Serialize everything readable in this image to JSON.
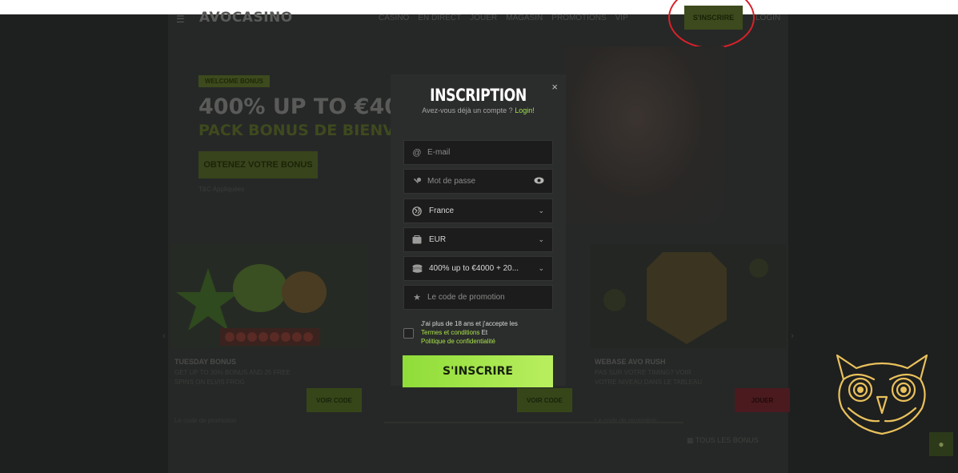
{
  "header": {
    "logo": "AVOCASINO",
    "nav": [
      "CASINO",
      "EN DIRECT",
      "JOUER",
      "MAGASIN",
      "PROMOTIONS",
      "VIP"
    ],
    "register": "S'INSCRIRE",
    "login": "LOGIN"
  },
  "hero": {
    "badge": "WELCOME BONUS",
    "title": "400% UP TO €4000 + 20",
    "subtitle": "PACK BONUS DE BIENVENUE",
    "cta": "OBTENEZ VOTRE BONUS",
    "note": "T&C Appliquées"
  },
  "cards": [
    {
      "title": "TUESDAY BONUS",
      "desc": "GET UP TO 30% BONUS AND 25 FREE SPINS ON ELVIS FROG",
      "promo": "Le code de promotion",
      "button": "VOIR CODE"
    },
    {
      "title": "WEBASE AVO RUSH",
      "desc": "PAS SUR VOTRE TIMING? VOIR VOTRE NIVEAU DANS LE TABLEAU",
      "promo": "Le code de promotion",
      "button": "JOUER"
    }
  ],
  "card_mid_button": "VOIR CODE",
  "footer": {
    "right": "TOUS LES BONUS"
  },
  "modal": {
    "close": "×",
    "title": "INSCRIPTION",
    "sub_text": "Avez-vous déjà un compte ?",
    "sub_link": "Login!",
    "email_placeholder": "E-mail",
    "password_placeholder": "Mot de passe",
    "country": "France",
    "currency": "EUR",
    "bonus": "400% up to €4000 + 20...",
    "promo_placeholder": "Le code de promotion",
    "terms_line1": "J'ai plus de 18 ans et j'accepte les",
    "terms_link1": "Termes et conditions",
    "terms_and": " Et",
    "terms_link2": "Politique de confidentialité",
    "submit": "S'INSCRIRE"
  },
  "colors": {
    "accent": "#a6e64a",
    "annotation": "#d9212a",
    "owl": "#e9c15c"
  }
}
